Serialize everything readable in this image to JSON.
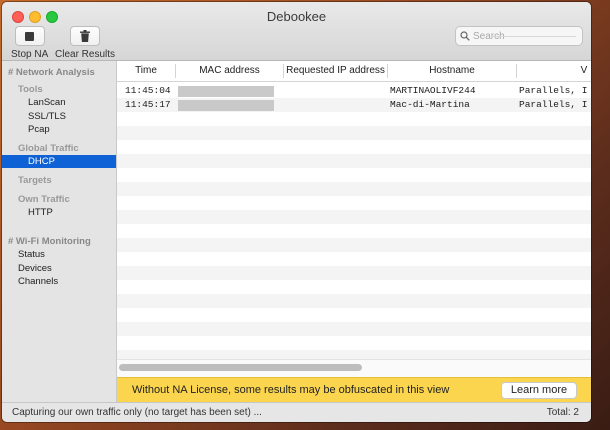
{
  "window": {
    "title": "Debookee"
  },
  "toolbar": {
    "stop_label": "Stop NA",
    "clear_label": "Clear Results"
  },
  "search": {
    "placeholder": "Search",
    "value": ""
  },
  "sidebar": {
    "network_analysis": "# Network Analysis",
    "tools": "Tools",
    "tool_items": [
      "LanScan",
      "SSL/TLS",
      "Pcap"
    ],
    "global_traffic": "Global Traffic",
    "global_items": [
      "DHCP"
    ],
    "selected": "DHCP",
    "targets": "Targets",
    "own_traffic": "Own Traffic",
    "own_items": [
      "HTTP"
    ],
    "wifi_monitoring": "# Wi-Fi Monitoring",
    "wifi_items": [
      "Status",
      "Devices",
      "Channels"
    ]
  },
  "table": {
    "columns": [
      "Time",
      "MAC address",
      "Requested IP address",
      "Hostname",
      "V"
    ],
    "rows": [
      {
        "time": "11:45:04",
        "mac": "",
        "requested_ip": "",
        "hostname": "MARTINAOLIVF244",
        "vendor": "Parallels, I"
      },
      {
        "time": "11:45:17",
        "mac": "",
        "requested_ip": "",
        "hostname": "Mac-di-Martina",
        "vendor": "Parallels, I"
      }
    ]
  },
  "banner": {
    "text": "Without NA License, some results may be obfuscated in this view",
    "button_label": "Learn more"
  },
  "status": {
    "left": "Capturing our own traffic only (no target has been set) ...",
    "right": "Total: 2"
  },
  "colors": {
    "accent": "#0f62d6",
    "banner": "#fbd54d"
  },
  "icons": {
    "stop": "stop-icon",
    "clear": "trash-icon",
    "search": "search-icon"
  }
}
